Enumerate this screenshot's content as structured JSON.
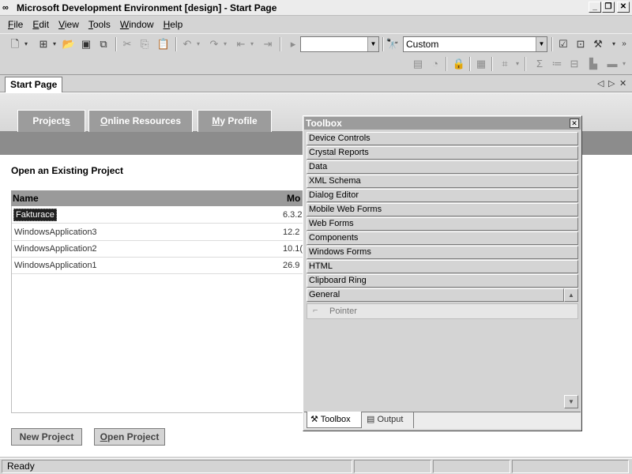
{
  "window": {
    "app_icon": "∞",
    "title": "Microsoft Development Environment [design] - Start Page",
    "minimize_glyph": "_",
    "maximize_glyph": "❐",
    "close_glyph": "✕"
  },
  "menu": [
    {
      "key": "F",
      "rest": "ile"
    },
    {
      "key": "E",
      "rest": "dit"
    },
    {
      "key": "V",
      "rest": "iew"
    },
    {
      "key": "T",
      "rest": "ools"
    },
    {
      "key": "W",
      "rest": "indow"
    },
    {
      "key": "H",
      "rest": "elp"
    }
  ],
  "toolbar": {
    "config_combo_value": "",
    "platform_combo_value": "Custom",
    "icons": [
      "new-project-icon",
      "add-item-icon",
      "open-icon",
      "save-icon",
      "save-all-icon",
      "cut-icon",
      "copy-icon",
      "paste-icon",
      "undo-icon",
      "redo-icon",
      "navigate-back-icon",
      "navigate-forward-icon",
      "start-icon",
      "find-icon",
      "solution-explorer-icon",
      "properties-icon",
      "toolbox-icon"
    ]
  },
  "doc": {
    "tab_label": "Start Page",
    "nav_prev": "◁",
    "nav_next": "▷",
    "nav_close": "✕"
  },
  "start_page": {
    "tabs": [
      {
        "label_pre": "Project",
        "label_key": "s",
        "label_post": ""
      },
      {
        "label_pre": "",
        "label_key": "O",
        "label_post": "nline Resources"
      },
      {
        "label_pre": "",
        "label_key": "M",
        "label_post": "y Profile"
      }
    ],
    "open_heading": "Open an Existing Project",
    "table_headers": [
      "Name",
      "Mo"
    ],
    "projects": [
      {
        "name": "Fakturace",
        "modified": "6.3.2"
      },
      {
        "name": "WindowsApplication3",
        "modified": "12.2"
      },
      {
        "name": "WindowsApplication2",
        "modified": "10.1("
      },
      {
        "name": "WindowsApplication1",
        "modified": "26.9"
      }
    ],
    "new_project_pre": "New Project",
    "open_project_key": "O",
    "open_project_rest": "pen Project"
  },
  "toolbox": {
    "title": "Toolbox",
    "close_glyph": "✕",
    "categories": [
      "Device Controls",
      "Crystal Reports",
      "Data",
      "XML Schema",
      "Dialog Editor",
      "Mobile Web Forms",
      "Web Forms",
      "Components",
      "Windows Forms",
      "HTML",
      "Clipboard Ring",
      "General"
    ],
    "pointer_label": "Pointer",
    "pointer_glyph": "⌐",
    "scroll_up": "▲",
    "scroll_down": "▼",
    "tabs": [
      "Toolbox",
      "Output"
    ]
  },
  "status": {
    "text": "Ready"
  }
}
